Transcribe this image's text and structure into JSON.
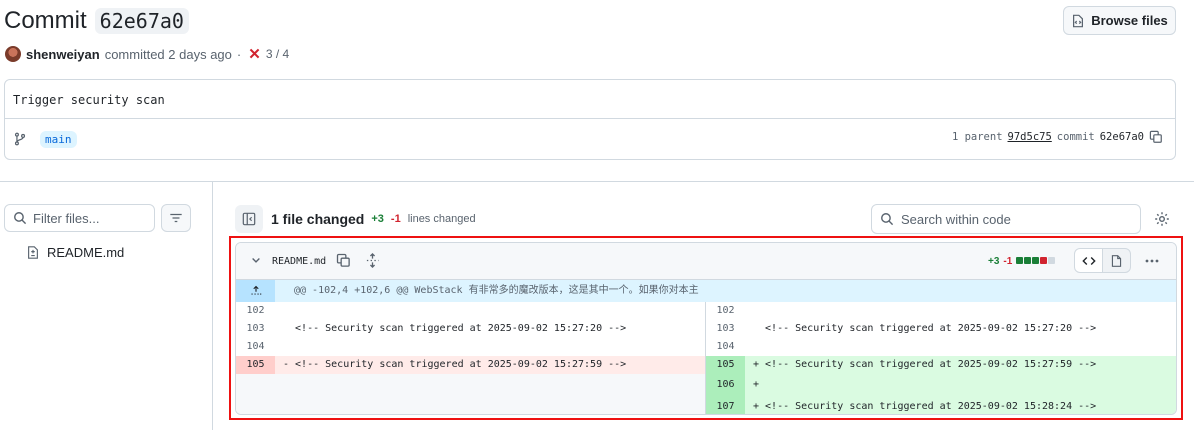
{
  "header": {
    "title": "Commit",
    "sha": "62e67a0",
    "browse_label": "Browse files"
  },
  "meta": {
    "author": "shenweiyan",
    "action": "committed 2 days ago",
    "separator": "·",
    "checks": "3 / 4",
    "check_status": "failing"
  },
  "commit": {
    "message": "Trigger security scan",
    "branch": "main",
    "parent_label": "1 parent",
    "parent_sha": "97d5c75",
    "commit_label": "commit",
    "commit_sha": "62e67a0"
  },
  "sidebar": {
    "filter_placeholder": "Filter files...",
    "files": [
      "README.md"
    ]
  },
  "toolbar": {
    "files_changed": "1 file changed",
    "additions": "+3",
    "deletions": "-1",
    "lines_changed": "lines changed",
    "search_placeholder": "Search within code"
  },
  "file": {
    "name": "README.md",
    "additions": "+3",
    "deletions": "-1",
    "hunk_header": "@@ -102,4 +102,6 @@ WebStack 有非常多的魔改版本，这是其中一个。如果你对本主",
    "rows": [
      {
        "left_num": "102",
        "left_code": "",
        "right_num": "102",
        "right_code": ""
      },
      {
        "left_num": "103",
        "left_code": "  <!-- Security scan triggered at 2025-09-02 15:27:20 -->",
        "right_num": "103",
        "right_code": "  <!-- Security scan triggered at 2025-09-02 15:27:20 -->"
      },
      {
        "left_num": "104",
        "left_code": "",
        "right_num": "104",
        "right_code": ""
      },
      {
        "left_num": "105",
        "left_code": "- <!-- Security scan triggered at 2025-09-02 15:27:59 -->",
        "right_num": "105",
        "right_code": "+ <!-- Security scan triggered at 2025-09-02 15:27:59 -->"
      },
      {
        "left_num": "",
        "left_code": "",
        "right_num": "106",
        "right_code": "+"
      },
      {
        "left_num": "",
        "left_code": "",
        "right_num": "107",
        "right_code": "+ <!-- Security scan triggered at 2025-09-02 15:28:24 -->"
      }
    ]
  },
  "colors": {
    "addition": "#1a7f37",
    "deletion": "#d1242f",
    "highlight_border": "#ee1111",
    "link": "#0969da"
  }
}
